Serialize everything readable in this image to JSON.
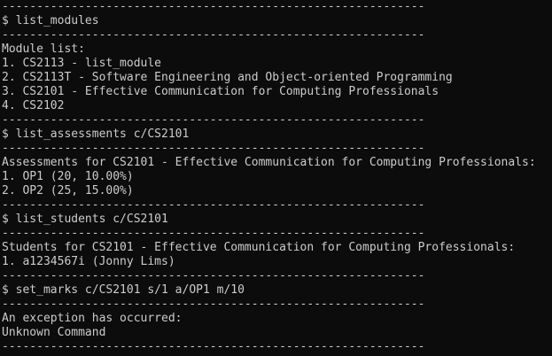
{
  "terminal": {
    "lines": [
      "-------------------------------------------------------------",
      "$ list_modules",
      "-------------------------------------------------------------",
      "Module list:",
      "1. CS2113 - list_module",
      "2. CS2113T - Software Engineering and Object-oriented Programming",
      "3. CS2101 - Effective Communication for Computing Professionals",
      "4. CS2102",
      "-------------------------------------------------------------",
      "$ list_assessments c/CS2101",
      "-------------------------------------------------------------",
      "Assessments for CS2101 - Effective Communication for Computing Professionals:",
      "1. OP1 (20, 10.00%)",
      "2. OP2 (25, 15.00%)",
      "-------------------------------------------------------------",
      "$ list_students c/CS2101",
      "-------------------------------------------------------------",
      "Students for CS2101 - Effective Communication for Computing Professionals:",
      "1. a1234567i (Jonny Lims)",
      "-------------------------------------------------------------",
      "$ set_marks c/CS2101 s/1 a/OP1 m/10",
      "-------------------------------------------------------------",
      "An exception has occurred:",
      "Unknown Command",
      "-------------------------------------------------------------"
    ],
    "colors": {
      "background": "#0c0c0c",
      "text": "#cccccc"
    }
  }
}
